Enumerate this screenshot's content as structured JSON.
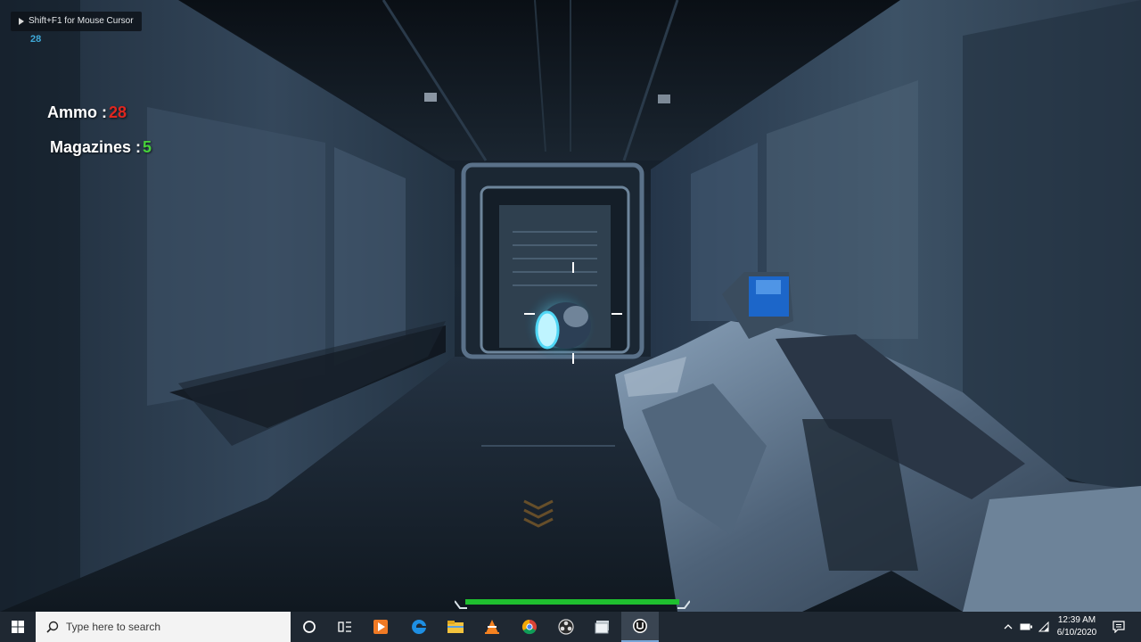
{
  "hud": {
    "hint": "Shift+F1 for Mouse Cursor",
    "fps": "28",
    "ammo_label": "Ammo :",
    "ammo_value": "28",
    "magazines_label": "Magazines :",
    "magazines_value": "5",
    "health_fraction": 1.0
  },
  "colors": {
    "ammo_value": "#e0261f",
    "magazines_value": "#46d13a",
    "fps": "#3fa9d8",
    "health": "#1fbf2f",
    "taskbar": "#1f2832"
  },
  "taskbar": {
    "search_placeholder": "Type here to search",
    "apps": [
      "start-icon",
      "cortana-icon",
      "task-view-icon",
      "media-player-icon",
      "edge-icon",
      "file-explorer-icon",
      "vlc-icon",
      "chrome-icon",
      "obs-icon",
      "photos-icon",
      "unreal-engine-icon"
    ],
    "tray_icons": [
      "chevron-up-icon",
      "battery-icon",
      "wifi-icon",
      "notification-icon"
    ],
    "time": "12:39 AM",
    "date": "6/10/2020"
  }
}
